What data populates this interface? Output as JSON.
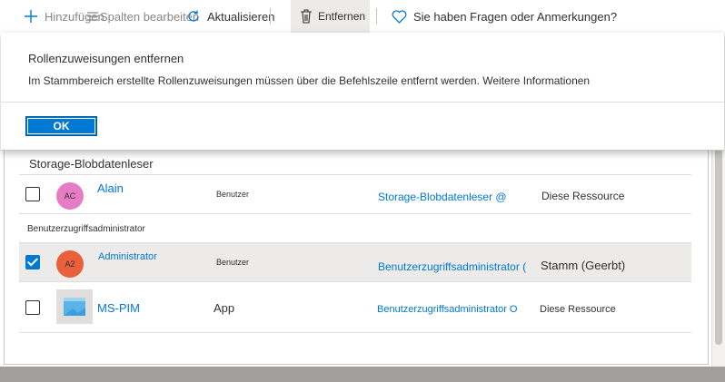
{
  "toolbar": {
    "add_label": "Hinzufügen",
    "columns_label": "Spalten bearbeiten",
    "refresh_label": "Aktualisieren",
    "remove_label": "Entfernen",
    "feedback_label": "Sie haben Fragen oder Anmerkungen?"
  },
  "dialog": {
    "title": "Rollenzuweisungen entfernen",
    "message": "Im Stammbereich erstellte Rollenzuweisungen müssen über die Befehlszeile entfernt werden.",
    "link": "Weitere Informationen",
    "ok_label": "OK"
  },
  "groups": [
    {
      "name": "Storage-Blobdatenleser",
      "rows": [
        {
          "checked": false,
          "initials": "AC",
          "avatar_color": "#e67cc4",
          "name": "Alain",
          "type": "Benutzer",
          "role": "Storage-Blobdatenleser @",
          "scope": "Diese Ressource"
        }
      ]
    },
    {
      "name": "Benutzerzugriffsadministrator",
      "rows": [
        {
          "checked": true,
          "initials": "A2",
          "avatar_color": "#e8603c",
          "name": "Administrator",
          "type": "Benutzer",
          "role": "Benutzerzugriffsadministrator (",
          "scope": "Stamm (Geerbt)"
        },
        {
          "checked": false,
          "initials": "",
          "avatar_color": "",
          "name": "MS-PIM",
          "type": "App",
          "role": "Benutzerzugriffsadministrator O",
          "scope": "Diese Ressource"
        }
      ]
    }
  ],
  "colors": {
    "accent": "#0078d4",
    "selected_row": "#edebe9"
  }
}
